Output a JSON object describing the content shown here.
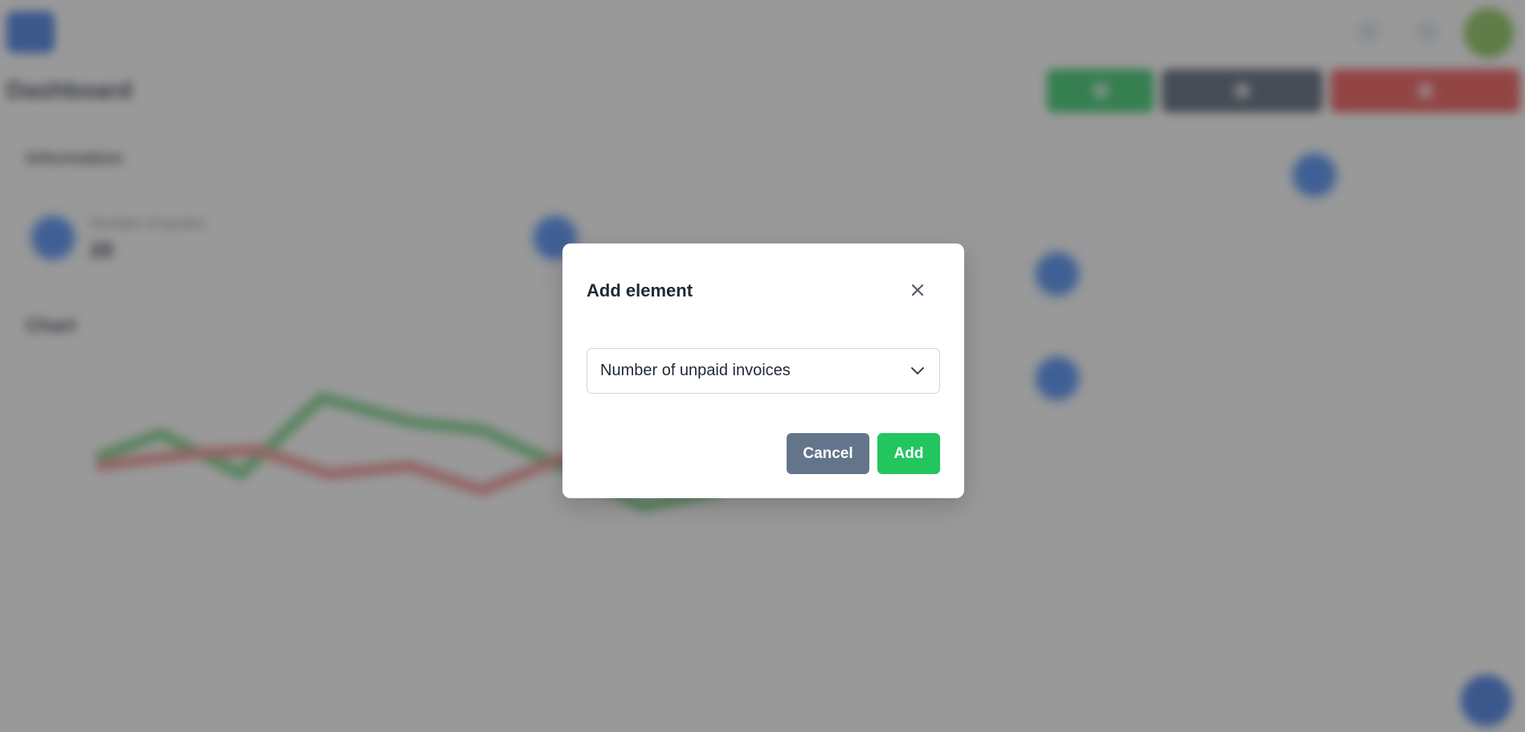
{
  "modal": {
    "title": "Add element",
    "select_value": "Number of unpaid invoices",
    "cancel_label": "Cancel",
    "add_label": "Add",
    "close_icon": "close-icon",
    "chevron_icon": "chevron-down-icon"
  },
  "colors": {
    "overlay": "#464646",
    "add_button": "#22c55e",
    "cancel_button": "#64748b",
    "primary": "#2f6fe4",
    "danger": "#ef4444"
  }
}
